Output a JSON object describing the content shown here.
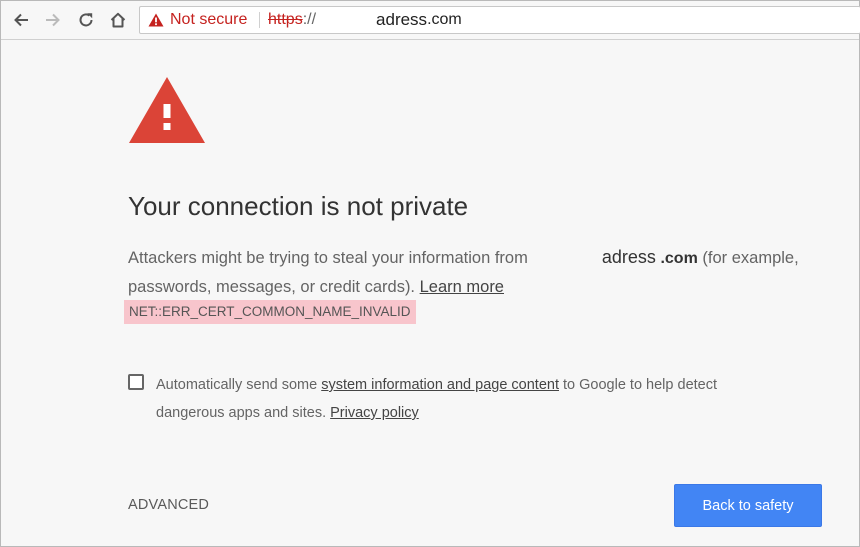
{
  "toolbar": {
    "back_icon": "arrow-left-icon",
    "forward_icon": "arrow-right-icon",
    "reload_icon": "reload-icon",
    "home_icon": "home-icon",
    "security_status": "Not secure",
    "url_scheme": "https",
    "url_separator": "://",
    "url_host": "adress",
    "url_tld": ".com"
  },
  "main": {
    "title": "Your connection is not private",
    "desc_part1": "Attackers might be trying to steal your information from",
    "desc_host": "adress",
    "desc_tld": ".com",
    "desc_part2": " (for example, passwords, messages, or credit cards). ",
    "learn_more": "Learn more",
    "error_code": "NET::ERR_CERT_COMMON_NAME_INVALID"
  },
  "optin": {
    "text1": "Automatically send some ",
    "link1": "system information and page content",
    "text2": " to Google to help detect dangerous apps and sites. ",
    "link2": "Privacy policy",
    "checked": false
  },
  "actions": {
    "advanced_label": "ADVANCED",
    "back_to_safety_label": "Back to safety"
  },
  "colors": {
    "accent": "#4285f4",
    "danger": "#c5221f",
    "warning_icon": "#db4437",
    "error_code_bg": "#f8c5cc",
    "page_bg": "#f7f7f7"
  }
}
